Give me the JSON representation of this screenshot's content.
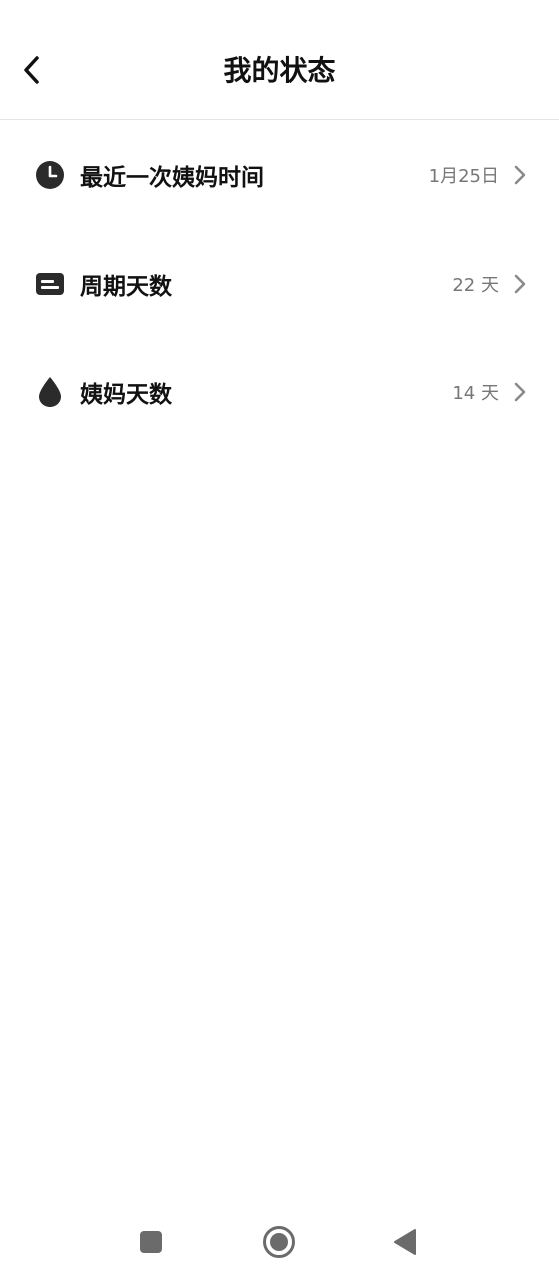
{
  "header": {
    "title": "我的状态",
    "back_icon": "chevron-left-icon"
  },
  "rows": [
    {
      "label": "最近一次姨妈时间",
      "value": "1月25日",
      "icon": "clock-icon"
    },
    {
      "label": "周期天数",
      "value": "22 天",
      "icon": "card-icon"
    },
    {
      "label": "姨妈天数",
      "value": "14 天",
      "icon": "drop-icon"
    }
  ],
  "navbar": {
    "recent_icon": "square-icon",
    "home_icon": "circle-icon",
    "back_icon": "triangle-back-icon"
  },
  "colors": {
    "text_primary": "#111111",
    "text_secondary": "#777777",
    "icon_dark": "#2b2b2b",
    "chevron": "#8a8a8a",
    "divider": "#e4e4e4",
    "navbar_icon": "#6b6b6b"
  }
}
